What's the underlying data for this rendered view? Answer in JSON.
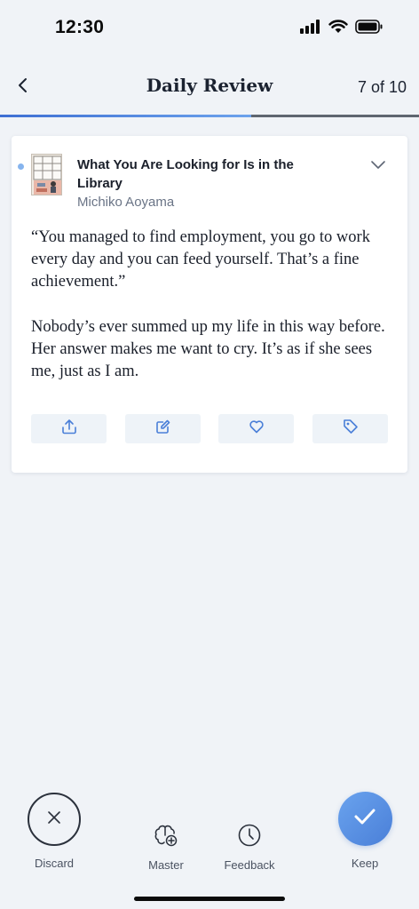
{
  "status_bar": {
    "time": "12:30"
  },
  "header": {
    "title": "Daily Review",
    "progress_text": "7 of 10",
    "progress_fraction": 0.6
  },
  "card": {
    "book_title": "What You Are Looking for Is in the Library",
    "author": "Michiko Aoyama",
    "highlight": "“You managed to find employment, you go to work every day and you can feed yourself. That’s a fine achievement.”",
    "note": "Nobody’s ever summed up my life in this way before. Her answer makes me want to cry. It’s as if she sees me, just as I am.",
    "actions": [
      "share-icon",
      "edit-icon",
      "heart-icon",
      "tag-icon"
    ]
  },
  "bottom_bar": {
    "discard_label": "Discard",
    "master_label": "Master",
    "feedback_label": "Feedback",
    "keep_label": "Keep"
  },
  "colors": {
    "accent": "#4a7fd8",
    "background": "#f0f3f7",
    "action_bg": "#eef3f8",
    "unread_dot": "#86b4ee"
  }
}
